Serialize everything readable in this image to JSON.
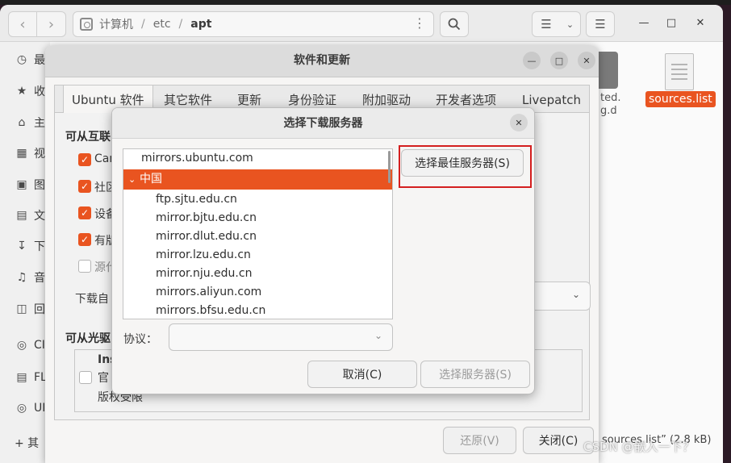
{
  "file_manager": {
    "path": {
      "root": "计算机",
      "segments": [
        "etc",
        "apt"
      ],
      "current": "apt"
    },
    "sidebar": [
      "最",
      "收",
      "主",
      "视",
      "图",
      "文",
      "下",
      "音",
      "回",
      "CI",
      "FL",
      "UI",
      "+ 其"
    ],
    "files": {
      "partial_name_line1": "ted.",
      "partial_name_line2": "g.d",
      "selected_file": "sources.list"
    },
    "status": "sources.list” (2.8 kB)"
  },
  "software_updates": {
    "title": "软件和更新",
    "tabs": [
      "Ubuntu 软件",
      "其它软件",
      "更新",
      "身份验证",
      "附加驱动",
      "开发者选项",
      "Livepatch"
    ],
    "section_internet": "可从互联",
    "checkboxes": [
      {
        "label": "Car",
        "checked": true
      },
      {
        "label": "社区",
        "checked": true
      },
      {
        "label": "设备",
        "checked": true
      },
      {
        "label": "有版",
        "checked": true
      },
      {
        "label": "源代",
        "checked": false
      }
    ],
    "download_from": "下载自",
    "section_cdrom": "可从光驱",
    "cdrom_line1": "Ins",
    "cdrom_line2": "官",
    "cdrom_line3": "版权受限",
    "revert_button": "还原(V)",
    "close_button": "关闭(C)"
  },
  "dialog": {
    "title": "选择下载服务器",
    "root_server": "mirrors.ubuntu.com",
    "selected_country": "中国",
    "servers": [
      "ftp.sjtu.edu.cn",
      "mirror.bjtu.edu.cn",
      "mirror.dlut.edu.cn",
      "mirror.lzu.edu.cn",
      "mirror.nju.edu.cn",
      "mirrors.aliyun.com",
      "mirrors.bfsu.edu.cn"
    ],
    "best_server_button": "选择最佳服务器(S)",
    "protocol_label": "协议：",
    "protocol_value": "",
    "cancel_button": "取消(C)",
    "choose_button": "选择服务器(S)"
  },
  "watermark": "CSDN @嵌入一下？",
  "colors": {
    "accent": "#e95420",
    "highlight_box": "#d41f1f"
  }
}
